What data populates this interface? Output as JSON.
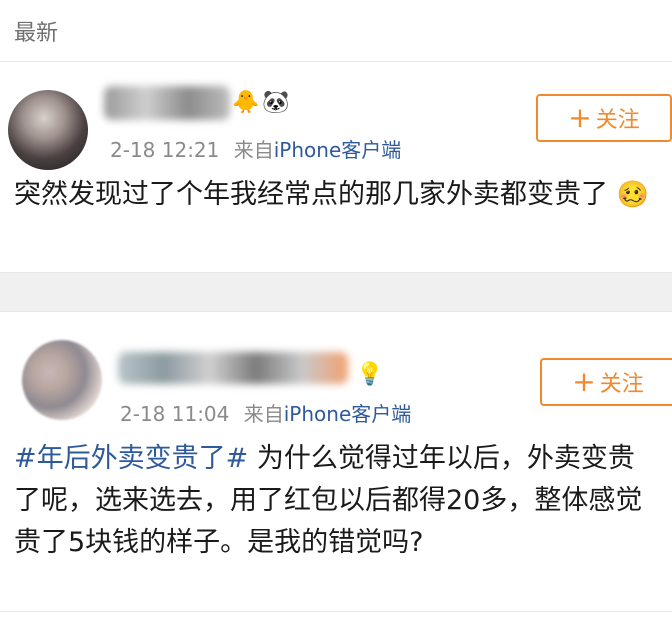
{
  "section": {
    "title": "最新"
  },
  "posts": [
    {
      "time": "2-18 12:21",
      "source_prefix": "来自",
      "source": "iPhone客户端",
      "follow_label": "关注",
      "follow_plus": "+",
      "text": "突然发现过了个年我经常点的那几家外卖都变贵了",
      "emoji": "🥴"
    },
    {
      "time": "2-18 11:04",
      "source_prefix": "来自",
      "source": "iPhone客户端",
      "follow_label": "关注",
      "follow_plus": "+",
      "hashtag": "#年后外卖变贵了#",
      "text": " 为什么觉得过年以后，外卖变贵了呢，选来选去，用了红包以后都得20多，整体感觉贵了5块钱的样子。是我的错觉吗?"
    }
  ],
  "icons": {
    "badge_1": "🐥",
    "badge_2": "🐼",
    "badge_3": "💡"
  },
  "colors": {
    "accent": "#f08a2c",
    "link": "#2e5a9a",
    "meta": "#8a8a8a",
    "text": "#1a1a1a"
  }
}
